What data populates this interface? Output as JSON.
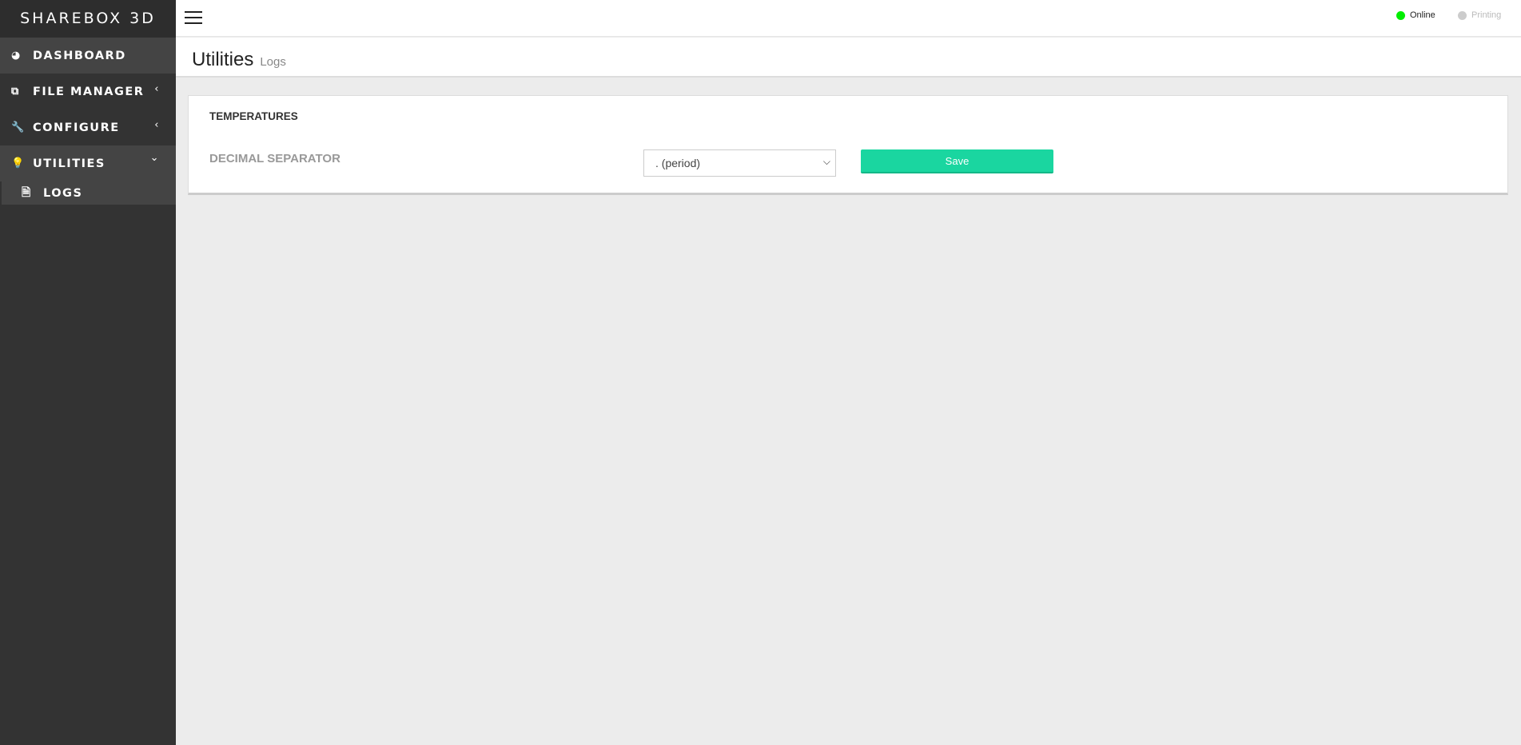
{
  "app": {
    "logo": "SHAREBOX 3D"
  },
  "sidebar": {
    "items": [
      {
        "label": "DASHBOARD",
        "icon": "dashboard-icon",
        "glyph": "◕"
      },
      {
        "label": "FILE MANAGER",
        "icon": "files-icon",
        "glyph": "⧉",
        "chevron": "‹"
      },
      {
        "label": "CONFIGURE",
        "icon": "wrench-icon",
        "glyph": "🔧",
        "chevron": "‹"
      },
      {
        "label": "UTILITIES",
        "icon": "lightbulb-icon",
        "glyph": "💡",
        "chevron": "⌄"
      }
    ],
    "subitems": [
      {
        "label": "LOGS",
        "icon": "document-icon",
        "glyph": "🗎"
      }
    ]
  },
  "topbar": {
    "status": [
      {
        "label": "Online",
        "color": "#00ee00"
      },
      {
        "label": "Printing",
        "color": "#cccccc"
      }
    ]
  },
  "header": {
    "title": "Utilities",
    "subtitle": "Logs"
  },
  "card": {
    "title": "TEMPERATURES",
    "field_label": "DECIMAL SEPARATOR",
    "select_value": ". (period)",
    "save_label": "Save"
  },
  "colors": {
    "accent": "#1ad6a0",
    "sidebar": "#333333"
  }
}
